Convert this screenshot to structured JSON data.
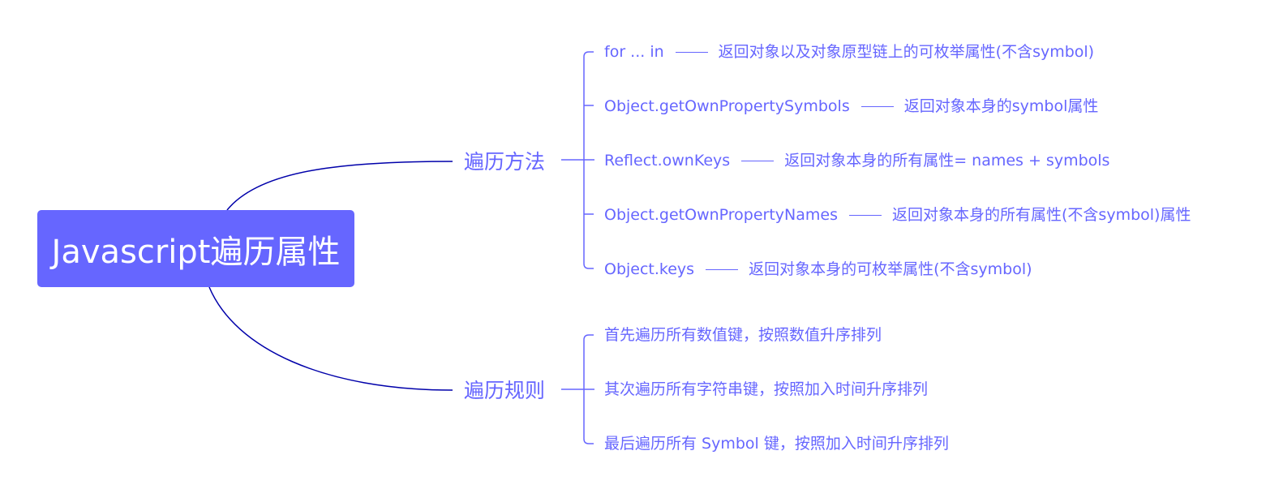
{
  "root": {
    "title": "Javascript遍历属性"
  },
  "branches": [
    {
      "label": "遍历方法",
      "items": [
        {
          "term": "for ... in",
          "description": "返回对象以及对象原型链上的可枚举属性(不含symbol)"
        },
        {
          "term": "Object.getOwnPropertySymbols",
          "description": "返回对象本身的symbol属性"
        },
        {
          "term": "Reflect.ownKeys",
          "description": "返回对象本身的所有属性= names + symbols"
        },
        {
          "term": "Object.getOwnPropertyNames",
          "description": "返回对象本身的所有属性(不含symbol)属性"
        },
        {
          "term": "Object.keys",
          "description": "返回对象本身的可枚举属性(不含symbol)"
        }
      ]
    },
    {
      "label": "遍历规则",
      "items": [
        {
          "text": "首先遍历所有数值键，按照数值升序排列"
        },
        {
          "text": "其次遍历所有字符串键，按照加入时间升序排列"
        },
        {
          "text": "最后遍历所有 Symbol 键，按照加入时间升序排列"
        }
      ]
    }
  ],
  "colors": {
    "root_fill": "#6666ff",
    "root_text": "#ffffff",
    "branch_text": "#6666ff",
    "main_connector": "#0000aa",
    "sub_connector": "#6666ff"
  }
}
